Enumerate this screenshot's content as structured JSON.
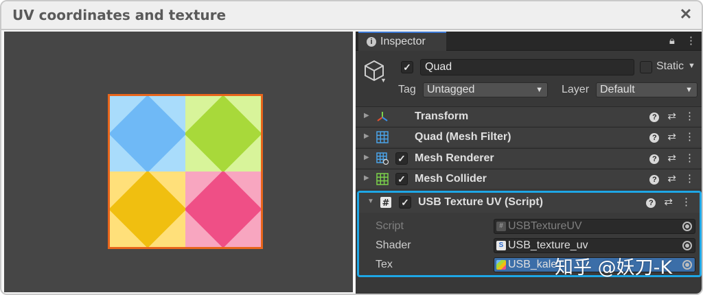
{
  "window": {
    "title": "UV coordinates and texture",
    "close_glyph": "✕"
  },
  "scene": {
    "tiles": [
      {
        "name": "blue",
        "bg": "#a9dcfb",
        "diamond": "#6fb9f6"
      },
      {
        "name": "green",
        "bg": "#d8f49a",
        "diamond": "#a8d93a"
      },
      {
        "name": "yellow",
        "bg": "#ffe07a",
        "diamond": "#f0bf10"
      },
      {
        "name": "pink",
        "bg": "#f8a6c0",
        "diamond": "#ef4f86"
      }
    ],
    "selection_outline_color": "#e8661c"
  },
  "inspector": {
    "tab_label": "Inspector",
    "gameobject": {
      "active_check": "✓",
      "name": "Quad",
      "static_label": "Static",
      "tag_label": "Tag",
      "tag_value": "Untagged",
      "layer_label": "Layer",
      "layer_value": "Default"
    },
    "components": [
      {
        "name": "Transform",
        "icon": "transform-icon",
        "has_checkbox": false
      },
      {
        "name": "Quad (Mesh Filter)",
        "icon": "mesh-filter-icon",
        "has_checkbox": false
      },
      {
        "name": "Mesh Renderer",
        "icon": "mesh-renderer-icon",
        "has_checkbox": true,
        "check": "✓"
      },
      {
        "name": "Mesh Collider",
        "icon": "mesh-collider-icon",
        "has_checkbox": true,
        "check": "✓"
      },
      {
        "name": "USB Texture UV (Script)",
        "icon": "script-icon",
        "has_checkbox": true,
        "check": "✓",
        "highlighted": true
      }
    ],
    "script_properties": [
      {
        "label": "Script",
        "value": "USBTextureUV",
        "disabled": true
      },
      {
        "label": "Shader",
        "value": "USB_texture_uv",
        "disabled": false
      },
      {
        "label": "Tex",
        "value": "USB_kale",
        "disabled": false
      }
    ],
    "highlight_color": "#1ea7e6"
  },
  "watermark": "知乎 @妖刀-K"
}
